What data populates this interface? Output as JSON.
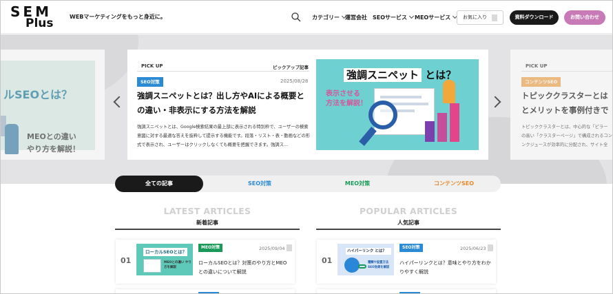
{
  "header": {
    "logo_line1": "SEM",
    "logo_line2": "Plus",
    "tagline": "WEBマーケティングをもっと身近に。",
    "nav": [
      {
        "label": "カテゴリー"
      },
      {
        "label": "運営会社"
      },
      {
        "label": "SEOサービス"
      },
      {
        "label": "MEOサービス"
      }
    ],
    "favorite_label": "お気に入り",
    "download_label": "資料ダウンロード",
    "contact_label": "お問い合わせ"
  },
  "carousel": {
    "left_card": {
      "headline": "ルSEOとは？",
      "subline1": "MEOとの違い",
      "subline2": "やり方を解説！"
    },
    "main_card": {
      "pickup": "PICK UP",
      "pickup_ja": "ピックアップ記事",
      "category": "SEO対策",
      "date": "2025/08/28",
      "title": "強調スニペットとは？出し方やAIによる概要との違い・非表示にする方法を解説",
      "excerpt": "強調スニペットとは、Google検索結果の最上部に表示される特別枠で、ユーザーの検索意図に対する最適な答えを抜粋して提示する機能です。段落・リスト・表・動画などの形式で表示され、ユーザーはクリックしなくても概要を把握できます。強調ス…",
      "image_headline": "強調スニペット",
      "image_headline_suffix": "とは？",
      "image_sub1": "表示させる",
      "image_sub2": "方法を解説！"
    },
    "right_card": {
      "pickup": "PICK UP",
      "category": "コンテンツSEO",
      "title_line1": "トピッククラスターとは",
      "title_line2": "とメリットを事例付きで",
      "excerpt_line1": "トピッククラスターとは、中心的な「ピラー",
      "excerpt_line2": "の高い「クラスターページ」で構成されるコン",
      "excerpt_line3": "ンクジュースが効率的に分配され、サイト全"
    }
  },
  "tabs": [
    {
      "label": "全ての記事",
      "color": "#ffffff",
      "active": true
    },
    {
      "label": "SEO対策",
      "color": "#2a8bd4",
      "active": false
    },
    {
      "label": "MEO対策",
      "color": "#1a9a5a",
      "active": false
    },
    {
      "label": "コンテンツSEO",
      "color": "#e8892b",
      "active": false
    }
  ],
  "latest": {
    "title_en": "LATEST ARTICLES",
    "title_ja": "新着記事",
    "items": [
      {
        "num": "01",
        "category": "MEO対策",
        "category_color": "#1a9a5a",
        "date": "2025/09/04",
        "title": "ローカルSEOとは？対策のやり方とMEOとの違いについて解説",
        "thumb_headline": "ローカルSEOとは？",
        "thumb_sub": "MEOとの違い やり方を解説"
      }
    ]
  },
  "popular": {
    "title_en": "POPULAR ARTICLES",
    "title_ja": "人気記事",
    "items": [
      {
        "num": "01",
        "category": "SEO対策",
        "category_color": "#2a8bd4",
        "date": "2025/06/23",
        "title": "ハイパーリンクとは？意味とやり方をわかりやすく解説",
        "thumb_headline": "ハイパーリンク とは？",
        "thumb_sub": "種類や設置方法 SEO効果を解説"
      }
    ]
  },
  "colors": {
    "seo": "#2a8bd4",
    "meo": "#1a9a5a",
    "contents_seo": "#e8892b",
    "contact": "#c77ab5"
  }
}
